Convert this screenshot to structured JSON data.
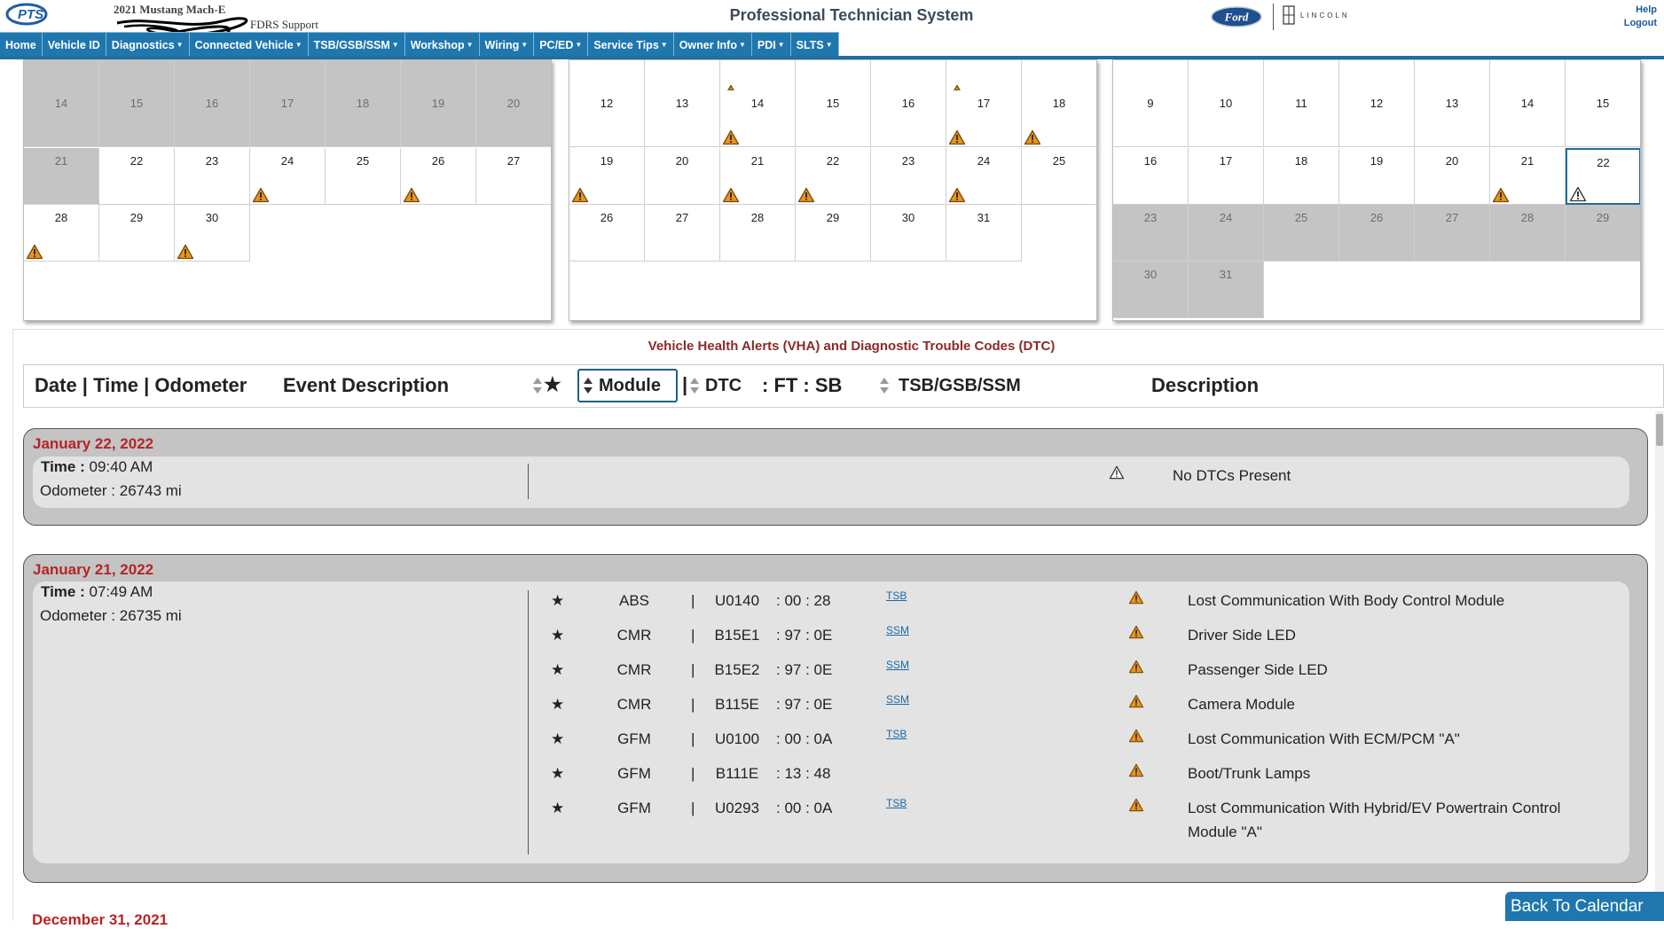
{
  "header": {
    "logo_text": "PTS",
    "vehicle_name": "2021 Mustang Mach-E",
    "support_label": "FDRS Support",
    "title": "Professional Technician System",
    "ford_logo_text": "Ford",
    "lincoln_text": "LINCOLN",
    "help": "Help",
    "logout": "Logout"
  },
  "nav": [
    {
      "label": "Home",
      "dropdown": false
    },
    {
      "label": "Vehicle ID",
      "dropdown": false
    },
    {
      "label": "Diagnostics",
      "dropdown": true
    },
    {
      "label": "Connected Vehicle",
      "dropdown": true
    },
    {
      "label": "TSB/GSB/SSM",
      "dropdown": true
    },
    {
      "label": "Workshop",
      "dropdown": true
    },
    {
      "label": "Wiring",
      "dropdown": true
    },
    {
      "label": "PC/ED",
      "dropdown": true
    },
    {
      "label": "Service Tips",
      "dropdown": true
    },
    {
      "label": "Owner Info",
      "dropdown": true
    },
    {
      "label": "PDI",
      "dropdown": true
    },
    {
      "label": "SLTS",
      "dropdown": true
    }
  ],
  "calendars": [
    {
      "rows": [
        [
          {
            "d": "",
            "g": true
          },
          {
            "d": "",
            "g": true
          },
          {
            "d": "",
            "g": true
          },
          {
            "d": "",
            "g": true
          },
          {
            "d": "",
            "g": true
          },
          {
            "d": "",
            "g": true
          },
          {
            "d": "",
            "g": true
          }
        ],
        [
          {
            "d": "14",
            "g": true
          },
          {
            "d": "15",
            "g": true
          },
          {
            "d": "16",
            "g": true
          },
          {
            "d": "17",
            "g": true
          },
          {
            "d": "18",
            "g": true
          },
          {
            "d": "19",
            "g": true
          },
          {
            "d": "20",
            "g": true
          }
        ],
        [
          {
            "d": "21",
            "g": true
          },
          {
            "d": "22"
          },
          {
            "d": "23"
          },
          {
            "d": "24",
            "a": true
          },
          {
            "d": "25"
          },
          {
            "d": "26",
            "a": true
          },
          {
            "d": "27"
          }
        ],
        [
          {
            "d": "28",
            "a": true
          },
          {
            "d": "29"
          },
          {
            "d": "30",
            "a": true
          }
        ]
      ]
    },
    {
      "rows": [
        [
          {
            "d": ""
          },
          {
            "d": ""
          },
          {
            "d": "",
            "a": true
          },
          {
            "d": ""
          },
          {
            "d": ""
          },
          {
            "d": "",
            "a": true
          },
          {
            "d": ""
          }
        ],
        [
          {
            "d": "12"
          },
          {
            "d": "13"
          },
          {
            "d": "14",
            "a": true
          },
          {
            "d": "15"
          },
          {
            "d": "16"
          },
          {
            "d": "17",
            "a": true
          },
          {
            "d": "18",
            "a": true
          }
        ],
        [
          {
            "d": "19",
            "a": true
          },
          {
            "d": "20"
          },
          {
            "d": "21",
            "a": true
          },
          {
            "d": "22",
            "a": true
          },
          {
            "d": "23"
          },
          {
            "d": "24",
            "a": true
          },
          {
            "d": "25"
          }
        ],
        [
          {
            "d": "26"
          },
          {
            "d": "27"
          },
          {
            "d": "28"
          },
          {
            "d": "29"
          },
          {
            "d": "30"
          },
          {
            "d": "31"
          }
        ]
      ]
    },
    {
      "rows": [
        [
          {
            "d": ""
          },
          {
            "d": ""
          },
          {
            "d": ""
          },
          {
            "d": ""
          },
          {
            "d": ""
          },
          {
            "d": ""
          },
          {
            "d": ""
          }
        ],
        [
          {
            "d": "9"
          },
          {
            "d": "10"
          },
          {
            "d": "11"
          },
          {
            "d": "12"
          },
          {
            "d": "13"
          },
          {
            "d": "14"
          },
          {
            "d": "15"
          }
        ],
        [
          {
            "d": "16"
          },
          {
            "d": "17"
          },
          {
            "d": "18"
          },
          {
            "d": "19"
          },
          {
            "d": "20"
          },
          {
            "d": "21",
            "a": true
          },
          {
            "d": "22",
            "n": true,
            "sel": true
          }
        ],
        [
          {
            "d": "23",
            "g": true
          },
          {
            "d": "24",
            "g": true
          },
          {
            "d": "25",
            "g": true
          },
          {
            "d": "26",
            "g": true
          },
          {
            "d": "27",
            "g": true
          },
          {
            "d": "28",
            "g": true
          },
          {
            "d": "29",
            "g": true
          }
        ],
        [
          {
            "d": "30",
            "g": true
          },
          {
            "d": "31",
            "g": true
          }
        ]
      ]
    }
  ],
  "vha": {
    "title": "Vehicle Health Alerts (VHA) and Diagnostic Trouble Codes (DTC)",
    "col_date": "Date | Time | Odometer",
    "col_event": "Event Description",
    "col_star": "★",
    "col_module": "Module",
    "col_pipe": "|",
    "col_dtc": "DTC",
    "col_ftsb": ": FT : SB",
    "col_tsb": "TSB/GSB/SSM",
    "col_desc": "Description"
  },
  "events": [
    {
      "date": "January 22, 2022",
      "time_label": "Time : ",
      "time": "09:40 AM",
      "odometer": "Odometer : 26743 mi",
      "summary": "No DTCs Present"
    },
    {
      "date": "January 21, 2022",
      "time_label": "Time : ",
      "time": "07:49 AM",
      "odometer": "Odometer : 26735 mi",
      "dtcs": [
        {
          "star": "★",
          "module": "ABS",
          "pipe": "|",
          "code": "U0140",
          "ftsb": ": 00 : 28",
          "link": "TSB",
          "desc": "Lost Communication With Body Control Module"
        },
        {
          "star": "★",
          "module": "CMR",
          "pipe": "|",
          "code": "B15E1",
          "ftsb": ": 97 : 0E",
          "link": "SSM",
          "desc": "Driver Side LED"
        },
        {
          "star": "★",
          "module": "CMR",
          "pipe": "|",
          "code": "B15E2",
          "ftsb": ": 97 : 0E",
          "link": "SSM",
          "desc": "Passenger Side LED"
        },
        {
          "star": "★",
          "module": "CMR",
          "pipe": "|",
          "code": "B115E",
          "ftsb": ": 97 : 0E",
          "link": "SSM",
          "desc": "Camera Module"
        },
        {
          "star": "★",
          "module": "GFM",
          "pipe": "|",
          "code": "U0100",
          "ftsb": ": 00 : 0A",
          "link": "TSB",
          "desc": "Lost Communication With ECM/PCM \"A\""
        },
        {
          "star": "★",
          "module": "GFM",
          "pipe": "|",
          "code": "B111E",
          "ftsb": ": 13 : 48",
          "link": "",
          "desc": "Boot/Trunk Lamps"
        },
        {
          "star": "★",
          "module": "GFM",
          "pipe": "|",
          "code": "U0293",
          "ftsb": ": 00 : 0A",
          "link": "TSB",
          "desc": "Lost Communication With Hybrid/EV Powertrain Control Module \"A\""
        }
      ]
    }
  ],
  "next_event_date": "December 31, 2021",
  "back_button": "Back To Calendar",
  "colors": {
    "nav_blue": "#1f77ad",
    "date_red": "#b52525",
    "title_red": "#8b2a2a",
    "alert_orange": "#e8941a",
    "grey_day": "#c4c4c4"
  }
}
